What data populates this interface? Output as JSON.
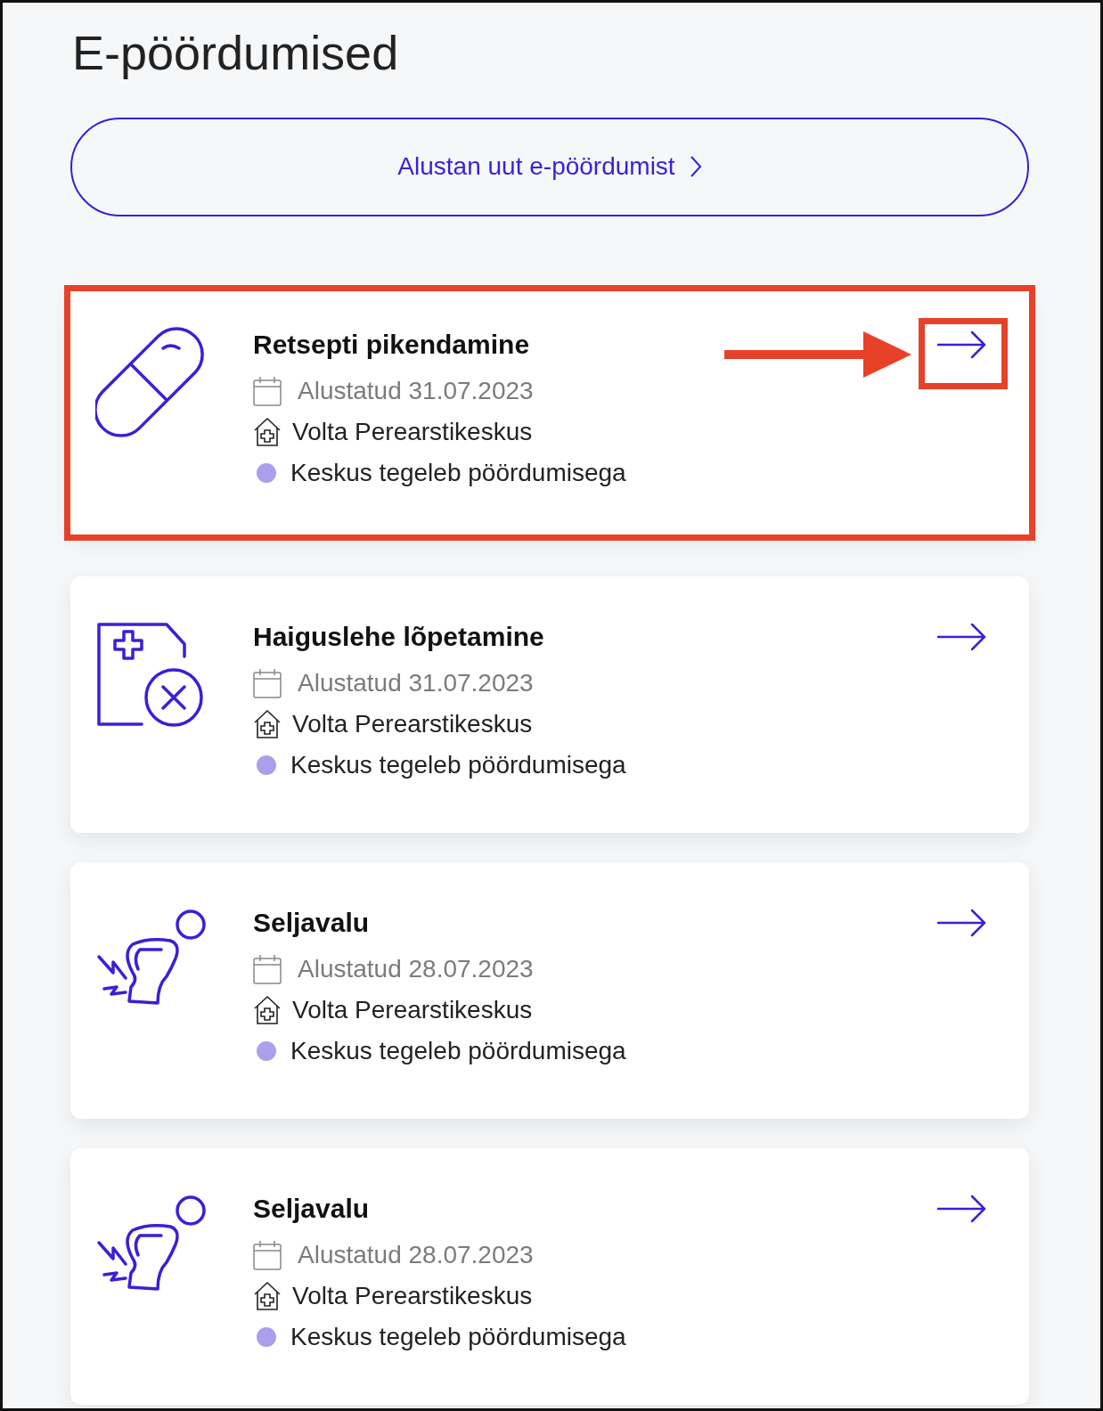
{
  "title": "E-pöördumised",
  "new_button": {
    "label": "Alustan uut e-pöördumist"
  },
  "cards": [
    {
      "kind": "pill",
      "title": "Retsepti pikendamine",
      "date": "Alustatud 31.07.2023",
      "clinic": "Volta Perearstikeskus",
      "status": "Keskus tegeleb pöördumisega",
      "color": "#ab9fec",
      "highlighted": true
    },
    {
      "kind": "sick-leave",
      "title": "Haiguslehe lõpetamine",
      "date": "Alustatud 31.07.2023",
      "clinic": "Volta Perearstikeskus",
      "status": "Keskus tegeleb pöördumisega",
      "color": "#ab9fec",
      "highlighted": false
    },
    {
      "kind": "back-pain",
      "title": "Seljavalu",
      "date": "Alustatud 28.07.2023",
      "clinic": "Volta Perearstikeskus",
      "status": "Keskus tegeleb pöördumisega",
      "color": "#ab9fec",
      "highlighted": false
    },
    {
      "kind": "back-pain",
      "title": "Seljavalu",
      "date": "Alustatud 28.07.2023",
      "clinic": "Volta Perearstikeskus",
      "status": "Keskus tegeleb pöördumisega",
      "color": "#ab9fec",
      "highlighted": false
    }
  ]
}
